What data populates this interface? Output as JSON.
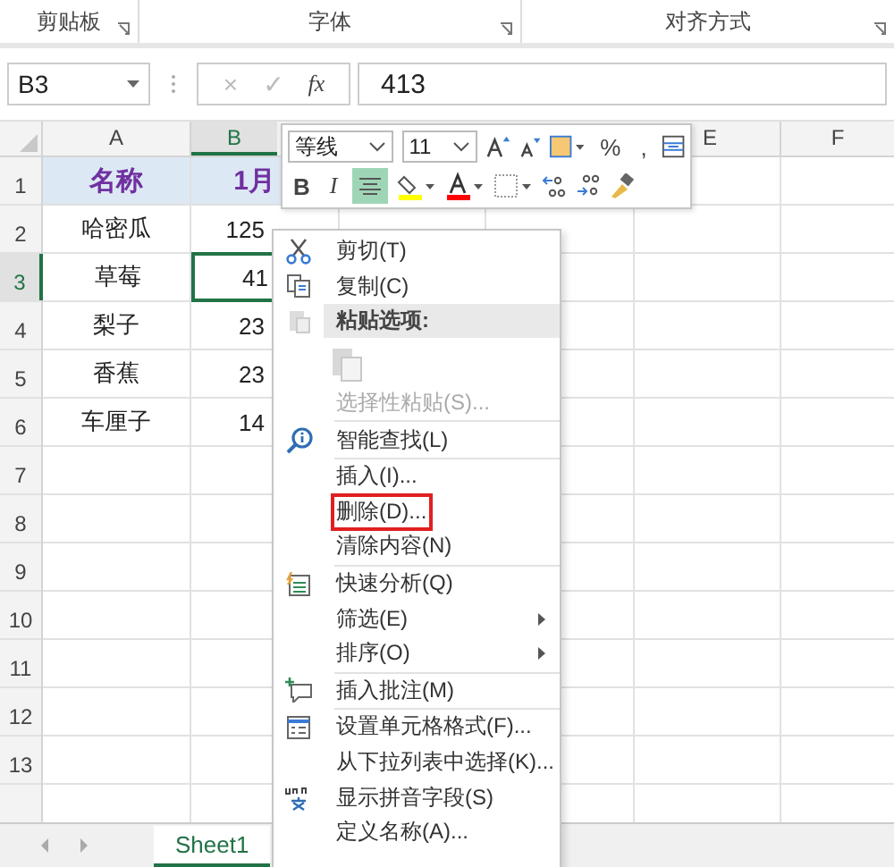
{
  "ribbon": {
    "groups": [
      "剪贴板",
      "字体",
      "对齐方式"
    ]
  },
  "formula_bar": {
    "name_box": "B3",
    "cancel": "×",
    "enter": "✓",
    "fx": "fx",
    "value": "413"
  },
  "columns": [
    {
      "label": "A",
      "selected": false
    },
    {
      "label": "B",
      "selected": true
    },
    {
      "label": "E",
      "selected": false
    },
    {
      "label": "F",
      "selected": false
    }
  ],
  "rows": [
    {
      "num": "1",
      "selected": false,
      "header": true,
      "cells": [
        "名称",
        "1月"
      ]
    },
    {
      "num": "2",
      "selected": false,
      "header": false,
      "cells": [
        "哈密瓜",
        "125"
      ]
    },
    {
      "num": "3",
      "selected": true,
      "header": false,
      "cells": [
        "草莓",
        "41"
      ]
    },
    {
      "num": "4",
      "selected": false,
      "header": false,
      "cells": [
        "梨子",
        "23"
      ]
    },
    {
      "num": "5",
      "selected": false,
      "header": false,
      "cells": [
        "香蕉",
        "23"
      ]
    },
    {
      "num": "6",
      "selected": false,
      "header": false,
      "cells": [
        "车厘子",
        "14"
      ]
    },
    {
      "num": "7",
      "selected": false,
      "cells": []
    },
    {
      "num": "8",
      "selected": false,
      "cells": []
    },
    {
      "num": "9",
      "selected": false,
      "cells": []
    },
    {
      "num": "10",
      "selected": false,
      "cells": []
    },
    {
      "num": "11",
      "selected": false,
      "cells": []
    },
    {
      "num": "12",
      "selected": false,
      "cells": []
    },
    {
      "num": "13",
      "selected": false,
      "cells": []
    }
  ],
  "mini_toolbar": {
    "font": "等线",
    "size": "11",
    "percent": "%",
    "comma": ",",
    "bold": "B",
    "italic": "I",
    "center_align_selected": true
  },
  "context_menu": [
    {
      "kind": "cut",
      "label": "剪切(T)",
      "disabled": false,
      "submenu": false,
      "highlighted": false
    },
    {
      "kind": "copy",
      "label": "复制(C)",
      "disabled": false,
      "submenu": false,
      "highlighted": false
    },
    {
      "kind": "header",
      "label": "粘贴选项:"
    },
    {
      "kind": "paste_option"
    },
    {
      "kind": "plain",
      "label": "选择性粘贴(S)...",
      "disabled": true,
      "submenu": false,
      "highlighted": false
    },
    {
      "kind": "separator"
    },
    {
      "kind": "lookup",
      "label": "智能查找(L)",
      "disabled": false,
      "submenu": false,
      "highlighted": false
    },
    {
      "kind": "separator"
    },
    {
      "kind": "plain",
      "label": "插入(I)...",
      "disabled": false,
      "submenu": false,
      "highlighted": false
    },
    {
      "kind": "plain",
      "label": "删除(D)...",
      "disabled": false,
      "submenu": false,
      "highlighted": true
    },
    {
      "kind": "plain",
      "label": "清除内容(N)",
      "disabled": false,
      "submenu": false,
      "highlighted": false
    },
    {
      "kind": "separator"
    },
    {
      "kind": "analysis",
      "label": "快速分析(Q)",
      "disabled": false,
      "submenu": false,
      "highlighted": false
    },
    {
      "kind": "plain",
      "label": "筛选(E)",
      "disabled": false,
      "submenu": true,
      "highlighted": false
    },
    {
      "kind": "plain",
      "label": "排序(O)",
      "disabled": false,
      "submenu": true,
      "highlighted": false
    },
    {
      "kind": "separator"
    },
    {
      "kind": "comment",
      "label": "插入批注(M)",
      "disabled": false,
      "submenu": false,
      "highlighted": false
    },
    {
      "kind": "separator"
    },
    {
      "kind": "format",
      "label": "设置单元格格式(F)...",
      "disabled": false,
      "submenu": false,
      "highlighted": false
    },
    {
      "kind": "plain",
      "label": "从下拉列表中选择(K)...",
      "disabled": false,
      "submenu": false,
      "highlighted": false
    },
    {
      "kind": "pinyin",
      "label": "显示拼音字段(S)",
      "disabled": false,
      "submenu": false,
      "highlighted": false
    },
    {
      "kind": "plain",
      "label": "定义名称(A)...",
      "disabled": false,
      "submenu": false,
      "highlighted": false
    }
  ],
  "sheet_tabs": [
    {
      "label": "Sheet1",
      "selected": true
    }
  ]
}
